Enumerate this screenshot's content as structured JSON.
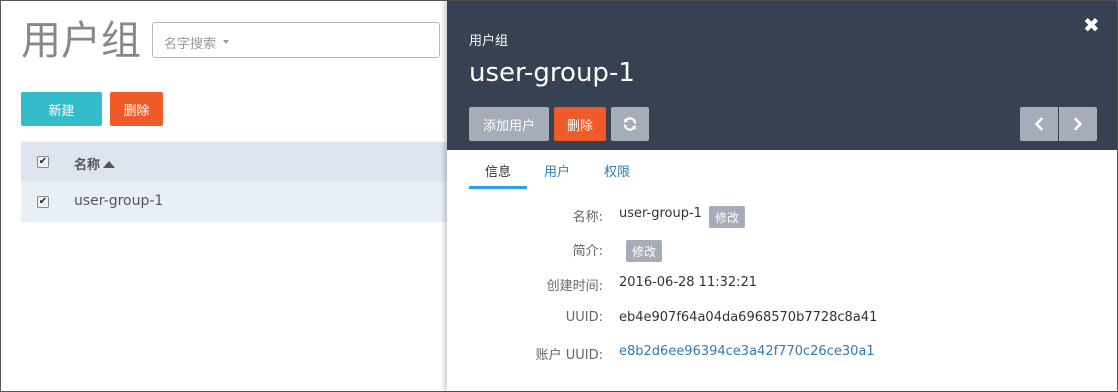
{
  "list": {
    "title": "用户组",
    "search_placeholder": "名字搜索",
    "new_label": "新建",
    "delete_label": "删除",
    "column_name": "名称",
    "rows": [
      {
        "name": "user-group-1",
        "checked": true
      }
    ]
  },
  "panel": {
    "subtitle": "用户组",
    "title": "user-group-1",
    "close_symbol": "✖",
    "add_user_label": "添加用户",
    "delete_label": "删除",
    "tabs": [
      "信息",
      "用户",
      "权限"
    ],
    "active_tab": "信息",
    "info": {
      "name_label": "名称:",
      "name_value": "user-group-1",
      "edit_label": "修改",
      "desc_label": "简介:",
      "desc_edit_label": "修改",
      "created_label": "创建时间:",
      "created_value": "2016-06-28 11:32:21",
      "uuid_label": "UUID:",
      "uuid_value": "eb4e907f64a04da6968570b7728c8a41",
      "account_uuid_label": "账户 UUID:",
      "account_uuid_value": "e8b2d6ee96394ce3a42f770c26ce30a1"
    }
  },
  "colors": {
    "header_bg": "#364152",
    "primary": "#35bcca",
    "danger": "#f05a28",
    "neutral_btn": "#a6adb8",
    "tab_underline": "#2e9ff3",
    "link": "#337ab7"
  }
}
